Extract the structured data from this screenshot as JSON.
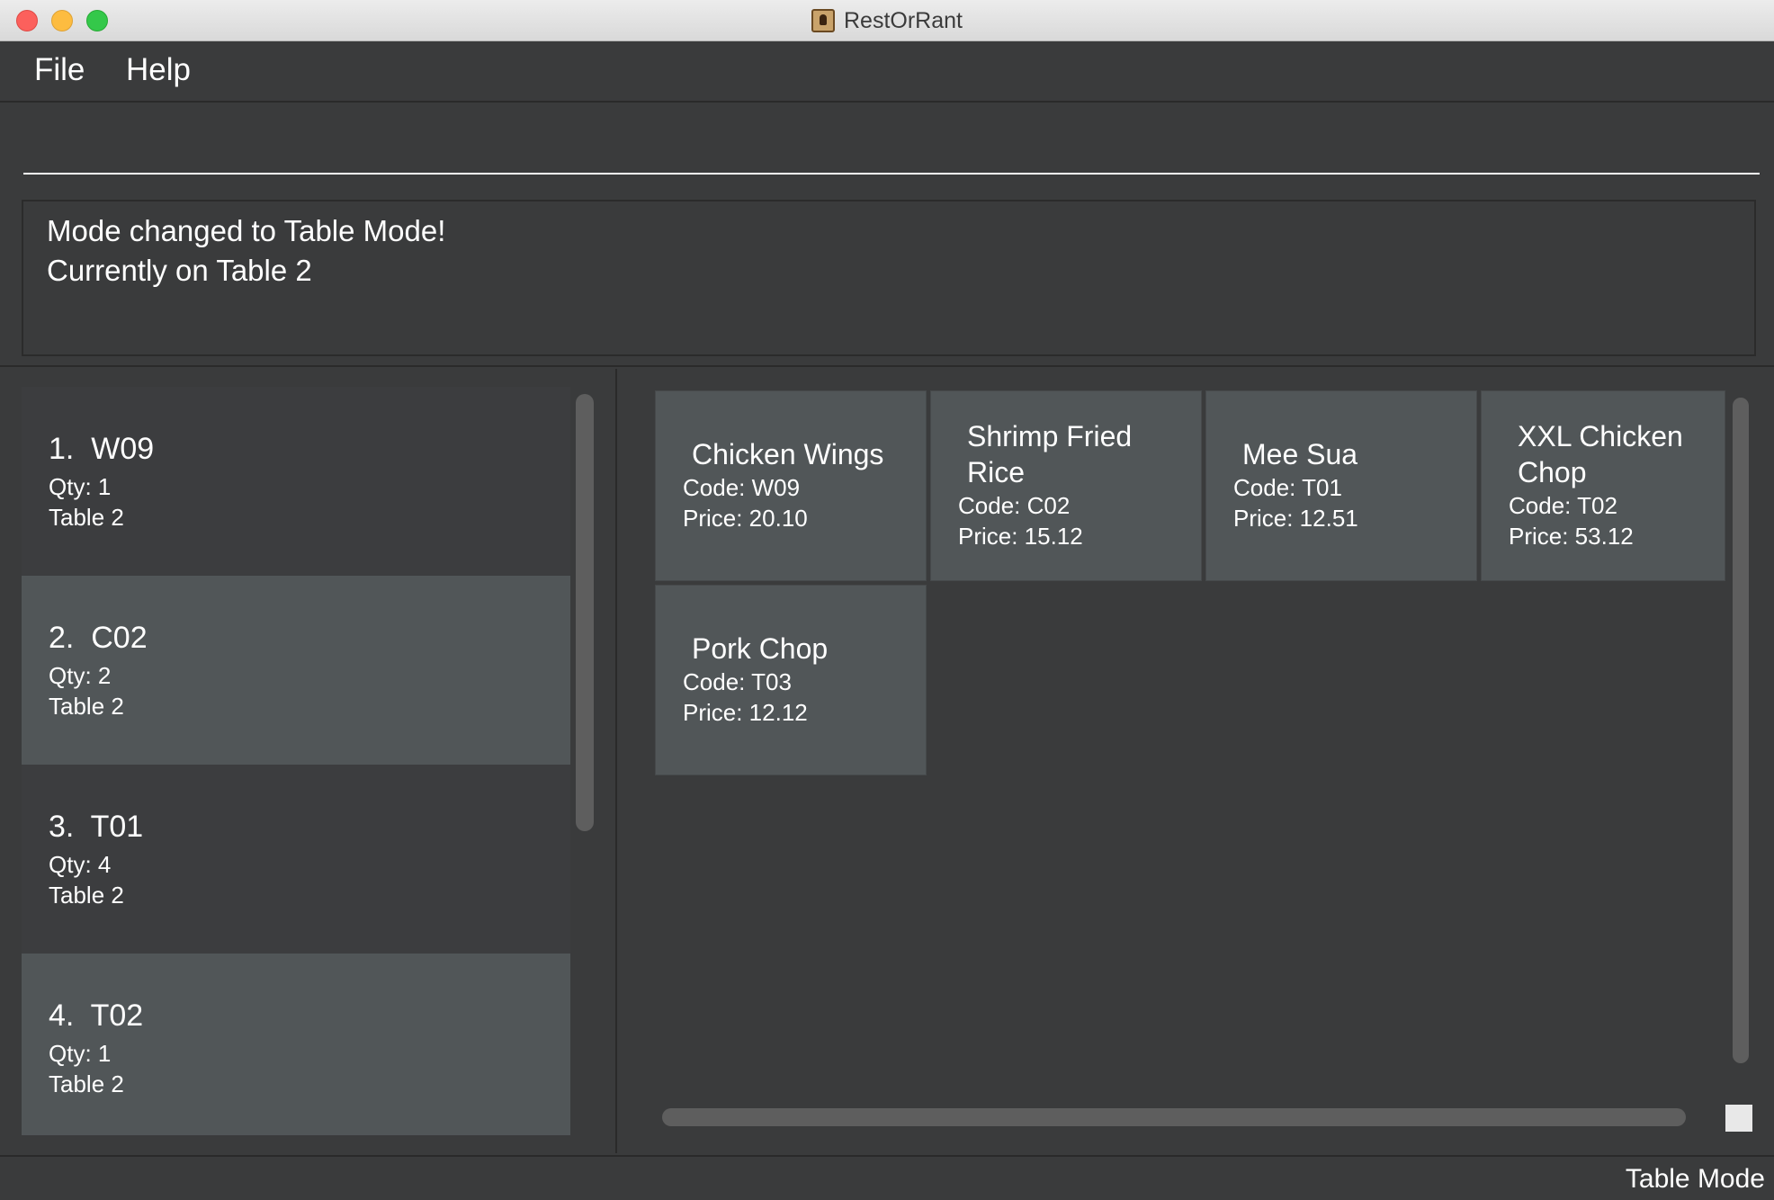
{
  "window": {
    "title": "RestOrRant"
  },
  "menu": {
    "file": "File",
    "help": "Help"
  },
  "command": {
    "value": ""
  },
  "result": {
    "line1": "Mode changed to Table Mode!",
    "line2": "Currently on Table 2"
  },
  "orders": [
    {
      "title": "1.  W09",
      "qty": "Qty: 1",
      "table": "Table 2"
    },
    {
      "title": "2.  C02",
      "qty": "Qty: 2",
      "table": "Table 2"
    },
    {
      "title": "3.  T01",
      "qty": "Qty: 4",
      "table": "Table 2"
    },
    {
      "title": "4.  T02",
      "qty": "Qty: 1",
      "table": "Table 2"
    }
  ],
  "menu_items": [
    {
      "name": "Chicken Wings",
      "code": "Code: W09",
      "price": "Price: 20.10"
    },
    {
      "name": "Shrimp Fried Rice",
      "code": "Code: C02",
      "price": "Price: 15.12"
    },
    {
      "name": "Mee Sua",
      "code": "Code: T01",
      "price": "Price: 12.51"
    },
    {
      "name": "XXL Chicken Chop",
      "code": "Code: T02",
      "price": "Price: 53.12"
    },
    {
      "name": "Pork Chop",
      "code": "Code: T03",
      "price": "Price: 12.12"
    }
  ],
  "status": {
    "mode": "Table Mode"
  },
  "colors": {
    "background": "#3a3b3c",
    "card": "#515658",
    "text": "#ffffff"
  }
}
